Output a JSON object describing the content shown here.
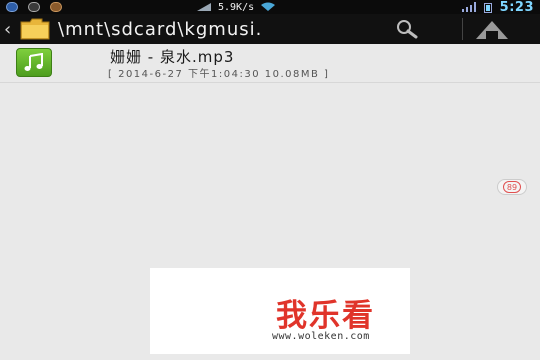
{
  "status_bar": {
    "left_icons": [
      "k-icon",
      "notification-icon",
      "app-icon"
    ],
    "net_speed": "5.9K/s",
    "time": "5:23"
  },
  "path_bar": {
    "path": "\\mnt\\sdcard\\kgmusi."
  },
  "files": [
    {
      "name": "姗姗 - 泉水.mp3",
      "meta": "[ 2014-6-27 下午1:04:30 10.08MB ]",
      "icon": "music-note-icon"
    }
  ],
  "side_badge": "89",
  "watermark": {
    "logo": "我乐看",
    "url": "www.woleken.com"
  },
  "colors": {
    "status_bar_bg": "#0b0b0b",
    "path_bar_bg": "#111111",
    "list_bg": "#e9e9e9",
    "file_icon_green": "#5cae26",
    "time_color": "#7fd6ff",
    "watermark_red": "#e0342a"
  }
}
